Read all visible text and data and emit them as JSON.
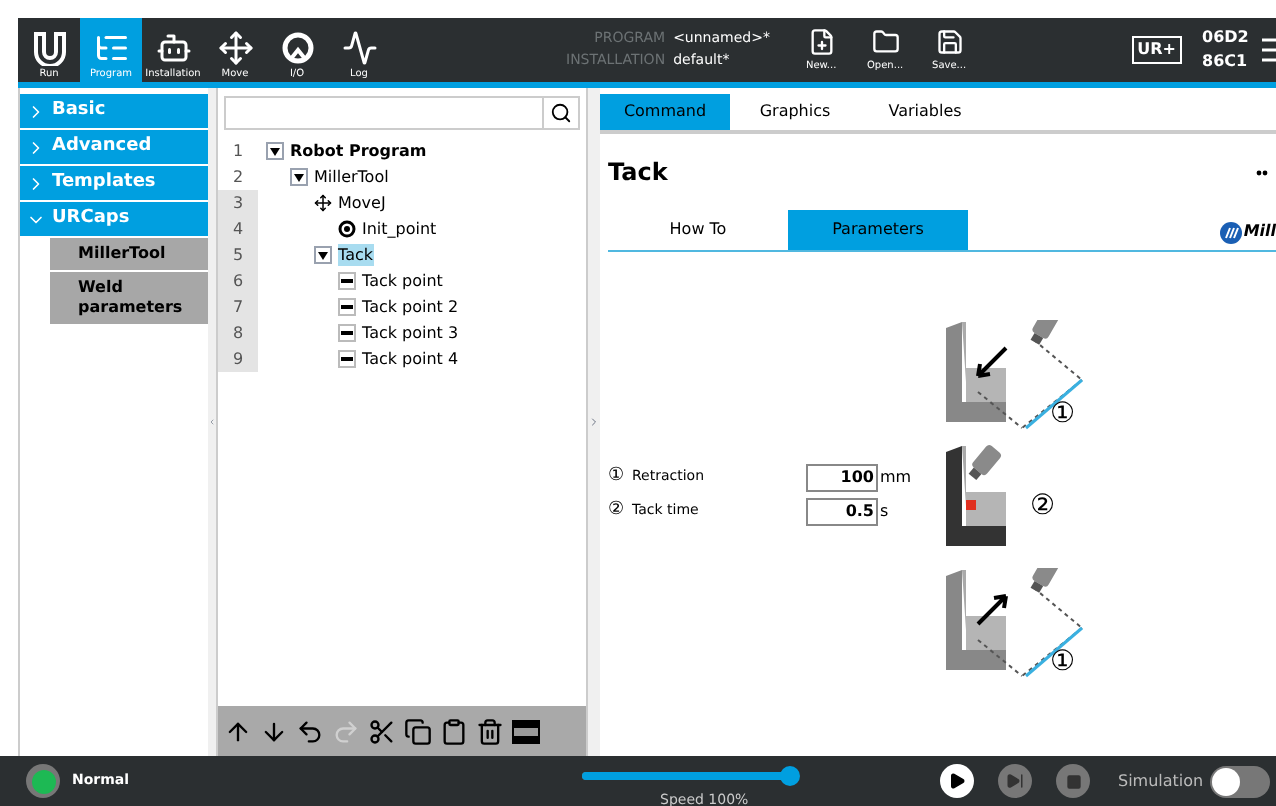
{
  "header": {
    "nav": [
      {
        "label": "Run",
        "kind": "run",
        "selected": false
      },
      {
        "label": "Program",
        "kind": "program",
        "selected": true
      },
      {
        "label": "Installation",
        "kind": "installation",
        "selected": false
      },
      {
        "label": "Move",
        "kind": "move",
        "selected": false
      },
      {
        "label": "I/O",
        "kind": "io",
        "selected": false
      },
      {
        "label": "Log",
        "kind": "log",
        "selected": false
      }
    ],
    "program_label": "PROGRAM",
    "program_value": "<unnamed>*",
    "installation_label": "INSTALLATION",
    "installation_value": "default*",
    "file_buttons": [
      {
        "label": "New...",
        "kind": "new"
      },
      {
        "label": "Open...",
        "kind": "open"
      },
      {
        "label": "Save...",
        "kind": "save"
      }
    ],
    "brand_badge": "UR+",
    "serial": [
      "06D2",
      "86C1"
    ]
  },
  "sidebar": {
    "items": [
      {
        "label": "Basic",
        "expanded": false
      },
      {
        "label": "Advanced",
        "expanded": false
      },
      {
        "label": "Templates",
        "expanded": false
      },
      {
        "label": "URCaps",
        "expanded": true,
        "children": [
          "MillerTool",
          "Weld parameters"
        ]
      }
    ]
  },
  "tree": [
    {
      "number": "1",
      "label": "Robot Program",
      "kind": "toggle",
      "selected": false,
      "children": [
        {
          "number": "2",
          "label": "MillerTool",
          "kind": "toggle",
          "selected": false,
          "children": [
            {
              "number": "3",
              "label": "MoveJ",
              "kind": "move",
              "selected": false,
              "children": [
                {
                  "number": "4",
                  "label": "Init_point",
                  "kind": "waypoint",
                  "selected": false
                }
              ]
            },
            {
              "number": "5",
              "label": "Tack",
              "kind": "toggle",
              "selected": true,
              "children": [
                {
                  "number": "6",
                  "label": "Tack point",
                  "kind": "point",
                  "selected": false
                },
                {
                  "number": "7",
                  "label": "Tack point 2",
                  "kind": "point",
                  "selected": false
                },
                {
                  "number": "8",
                  "label": "Tack point 3",
                  "kind": "point",
                  "selected": false
                },
                {
                  "number": "9",
                  "label": "Tack point 4",
                  "kind": "point",
                  "selected": false
                }
              ]
            }
          ]
        }
      ]
    }
  ],
  "tabs": [
    {
      "label": "Command",
      "selected": true
    },
    {
      "label": "Graphics",
      "selected": false
    },
    {
      "label": "Variables",
      "selected": false
    }
  ],
  "node_title": "Tack",
  "subtabs": [
    {
      "label": "How To",
      "selected": false
    },
    {
      "label": "Parameters",
      "selected": true
    }
  ],
  "logo_text": "Mill",
  "parameters": [
    {
      "marker": "①",
      "label": "Retraction",
      "value": "100",
      "unit": "mm"
    },
    {
      "marker": "②",
      "label": "Tack time",
      "value": "0.5",
      "unit": "s"
    }
  ],
  "diagrams": [
    {
      "kind": "approach",
      "marker": "①"
    },
    {
      "kind": "tack",
      "marker": "②"
    },
    {
      "kind": "retract",
      "marker": "①"
    }
  ],
  "footer": {
    "status": "Normal",
    "speed": {
      "level": 1.0,
      "reading": "Speed 100%"
    },
    "simulation": {
      "label": "Simulation",
      "on": false
    }
  }
}
